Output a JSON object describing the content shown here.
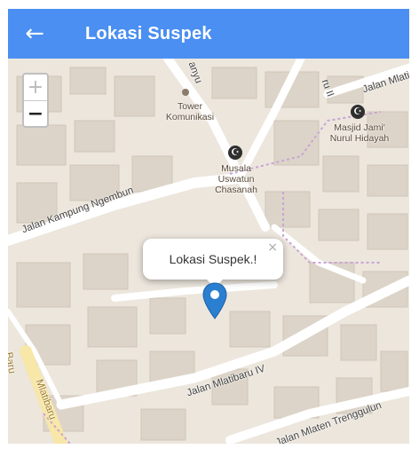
{
  "app_bar": {
    "back_icon": "arrow-left-icon",
    "title": "Lokasi Suspek",
    "color": "#4a8ff1"
  },
  "map": {
    "zoom_in_label": "+",
    "zoom_out_label": "−",
    "popup": {
      "text": "Lokasi Suspek.!",
      "close_label": "×"
    },
    "marker_color": "#2b7fd1",
    "labels": {
      "tower": "Tower Komunikasi",
      "musala": "Musala Uswatun Chasanah",
      "masjid": "Masjid Jami' Nurul Hidayah",
      "road_ngembun": "Jalan Kampung Ngembun",
      "road_mlatibaru": "Jalan Mlatibaru IV",
      "road_trenggulun": "Jalan Mlaten Trenggulun",
      "road_mlati_top": "Jalan Mlati",
      "road_baru_top": "ru II",
      "road_sanyu": "anyu",
      "road_left": "Mlatibaru",
      "road_left2": "Baru"
    }
  }
}
